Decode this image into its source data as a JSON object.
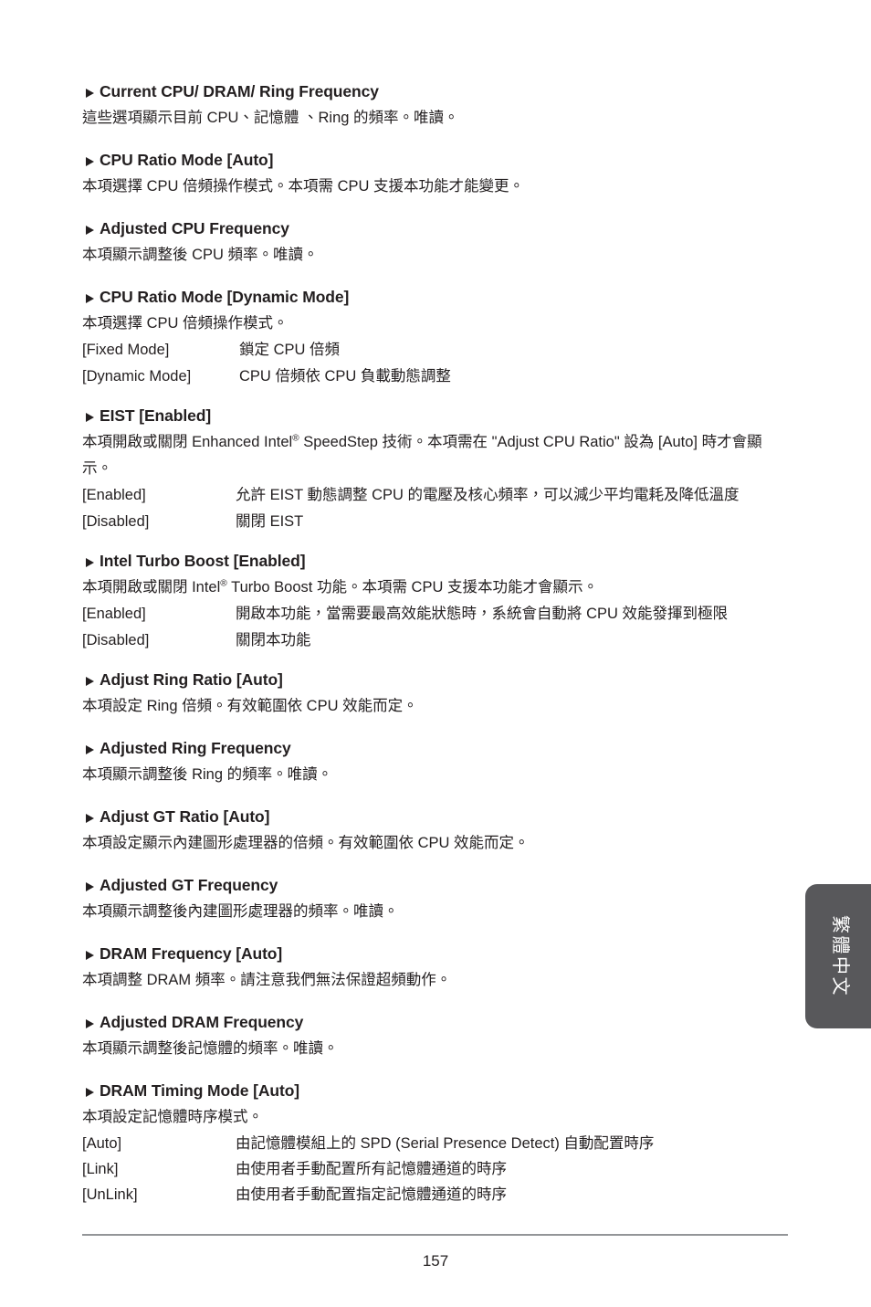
{
  "page": {
    "number": "157",
    "language_tab": "繁體中文",
    "triangle_icon": "triangle-right-icon"
  },
  "sections": [
    {
      "heading": "Current CPU/ DRAM/ Ring Frequency",
      "paragraphs": [
        "這些選項顯示目前 CPU、記憶體 、Ring 的頻率。唯讀。"
      ],
      "options": []
    },
    {
      "heading": "CPU Ratio Mode [Auto]",
      "paragraphs": [
        "本項選擇 CPU 倍頻操作模式。本項需 CPU 支援本功能才能變更。"
      ],
      "options": []
    },
    {
      "heading": "Adjusted CPU Frequency",
      "paragraphs": [
        "本項顯示調整後 CPU 頻率。唯讀。"
      ],
      "options": []
    },
    {
      "heading": "CPU Ratio Mode [Dynamic Mode]",
      "paragraphs": [
        "本項選擇 CPU 倍頻操作模式。"
      ],
      "options": [
        {
          "label": "[Fixed Mode]",
          "desc": "鎖定 CPU 倍頻"
        },
        {
          "label": "[Dynamic Mode]",
          "desc": "CPU 倍頻依 CPU 負載動態調整"
        }
      ]
    },
    {
      "heading": "EIST [Enabled]",
      "paragraphs": [
        "本項開啟或關閉 Enhanced Intel® SpeedStep 技術。本項需在 \"Adjust CPU Ratio\" 設為 [Auto] 時才會顯示。"
      ],
      "options": [
        {
          "label": "[Enabled]",
          "desc": "允許 EIST 動態調整 CPU 的電壓及核心頻率，可以減少平均電耗及降低溫度"
        },
        {
          "label": "[Disabled]",
          "desc": "關閉 EIST"
        }
      ]
    },
    {
      "heading": "Intel Turbo Boost [Enabled]",
      "paragraphs": [
        "本項開啟或關閉 Intel® Turbo Boost  功能。本項需 CPU 支援本功能才會顯示。"
      ],
      "options": [
        {
          "label": "[Enabled]",
          "desc": "開啟本功能，當需要最高效能狀態時，系統會自動將 CPU 效能發揮到極限"
        },
        {
          "label": "[Disabled]",
          "desc": "關閉本功能"
        }
      ]
    },
    {
      "heading": "Adjust Ring Ratio [Auto]",
      "paragraphs": [
        "本項設定 Ring 倍頻。有效範圍依 CPU 效能而定。"
      ],
      "options": []
    },
    {
      "heading": "Adjusted Ring Frequency",
      "paragraphs": [
        "本項顯示調整後 Ring 的頻率。唯讀。"
      ],
      "options": []
    },
    {
      "heading": "Adjust GT Ratio [Auto]",
      "paragraphs": [
        "本項設定顯示內建圖形處理器的倍頻。有效範圍依 CPU 效能而定。"
      ],
      "options": []
    },
    {
      "heading": "Adjusted GT Frequency",
      "paragraphs": [
        "本項顯示調整後內建圖形處理器的頻率。唯讀。"
      ],
      "options": []
    },
    {
      "heading": "DRAM Frequency [Auto]",
      "paragraphs": [
        "本項調整 DRAM 頻率。請注意我們無法保證超頻動作。"
      ],
      "options": []
    },
    {
      "heading": "Adjusted DRAM Frequency",
      "paragraphs": [
        "本項顯示調整後記憶體的頻率。唯讀。"
      ],
      "options": []
    },
    {
      "heading": "DRAM Timing Mode [Auto]",
      "paragraphs": [
        "本項設定記憶體時序模式。"
      ],
      "options": [
        {
          "label": "[Auto]",
          "desc": "由記憶體模組上的 SPD (Serial Presence Detect) 自動配置時序"
        },
        {
          "label": "[Link]",
          "desc": "由使用者手動配置所有記憶體通道的時序"
        },
        {
          "label": "[UnLink]",
          "desc": "由使用者手動配置指定記憶體通道的時序"
        }
      ]
    }
  ],
  "colors": {
    "text": "#231f20",
    "tab_background": "#58585b",
    "tab_text": "#ffffff",
    "rule": "#939598"
  }
}
